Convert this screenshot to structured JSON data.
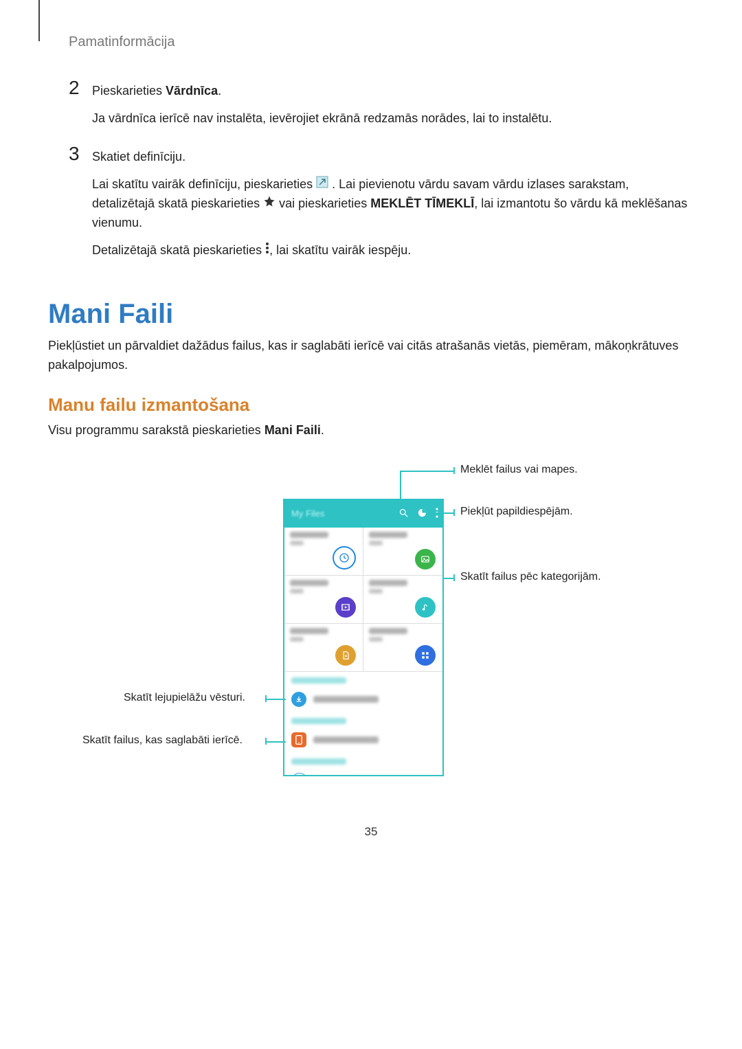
{
  "header": "Pamatinformācija",
  "steps": {
    "s2": {
      "num": "2",
      "line1a": "Pieskarieties ",
      "line1b": "Vārdnīca",
      "line1c": ".",
      "p2": "Ja vārdnīca ierīcē nav instalēta, ievērojiet ekrānā redzamās norādes, lai to instalētu."
    },
    "s3": {
      "num": "3",
      "p1": "Skatiet definīciju.",
      "p2a": "Lai skatītu vairāk definīciju, pieskarieties ",
      "p2b": ". Lai pievienotu vārdu savam vārdu izlases sarakstam, detalizētajā skatā pieskarieties ",
      "p2c": " vai pieskarieties ",
      "p2d": "MEKLĒT TĪMEKLĪ",
      "p2e": ", lai izmantotu šo vārdu kā meklēšanas vienumu.",
      "p3a": "Detalizētajā skatā pieskarieties ",
      "p3b": ", lai skatītu vairāk iespēju."
    }
  },
  "section_title": "Mani Faili",
  "section_body": "Piekļūstiet un pārvaldiet dažādus failus, kas ir saglabāti ierīcē vai citās atrašanās vietās, piemēram, mākoņkrātuves pakalpojumos.",
  "subsection_title": "Manu failu izmantošana",
  "sub_line_a": "Visu programmu sarakstā pieskarieties ",
  "sub_line_b": "Mani Faili",
  "sub_line_c": ".",
  "callouts": {
    "search": "Meklēt failus vai mapes.",
    "more": "Piekļūt papildiespējām.",
    "categories": "Skatīt failus pēc kategorijām.",
    "downloads": "Skatīt lejupielāžu vēsturi.",
    "device": "Skatīt failus, kas saglabāti ierīcē."
  },
  "phone": {
    "title": "My Files"
  },
  "page_number": "35"
}
